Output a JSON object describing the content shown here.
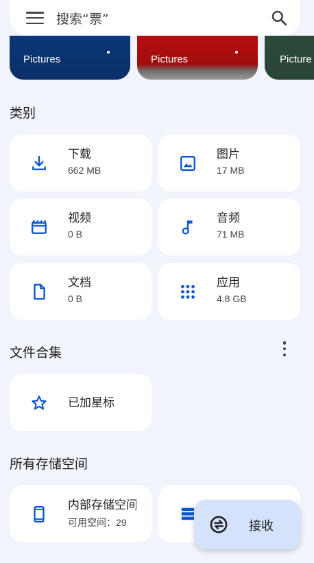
{
  "search": {
    "placeholder": "搜索“票”"
  },
  "recent": [
    {
      "label": "Pictures"
    },
    {
      "label": "Pictures"
    },
    {
      "label": "Picture"
    }
  ],
  "categories": {
    "title": "类别",
    "items": [
      {
        "name": "下载",
        "size": "662 MB",
        "icon": "download-icon"
      },
      {
        "name": "图片",
        "size": "17 MB",
        "icon": "image-icon"
      },
      {
        "name": "视频",
        "size": "0 B",
        "icon": "video-icon"
      },
      {
        "name": "音频",
        "size": "71 MB",
        "icon": "audio-icon"
      },
      {
        "name": "文档",
        "size": "0 B",
        "icon": "document-icon"
      },
      {
        "name": "应用",
        "size": "4.8 GB",
        "icon": "apps-grid-icon"
      }
    ]
  },
  "collections": {
    "title": "文件合集",
    "items": [
      {
        "name": "已加星标",
        "icon": "star-icon"
      }
    ]
  },
  "storage": {
    "title": "所有存储空间",
    "items": [
      {
        "name": "内部存储空间",
        "detail": "可用空间：29",
        "icon": "phone-icon"
      },
      {
        "icon": "storage-icon"
      }
    ]
  },
  "fab": {
    "label": "接收",
    "icon": "receive-icon"
  },
  "colors": {
    "accent": "#0b57d0",
    "background": "#f1f4fb",
    "fab": "#d4e2fb"
  }
}
